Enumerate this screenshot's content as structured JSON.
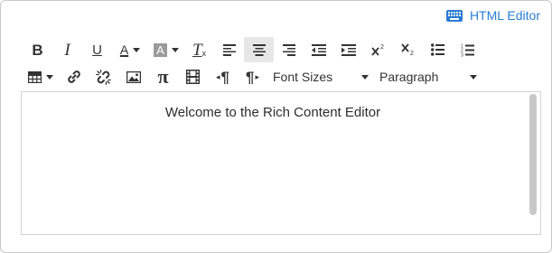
{
  "header": {
    "html_editor_label": "HTML Editor"
  },
  "toolbar": {
    "font_sizes_label": "Font Sizes",
    "paragraph_label": "Paragraph",
    "bold_glyph": "B",
    "italic_glyph": "I",
    "underline_glyph": "U",
    "text_color_glyph": "A",
    "bg_color_glyph": "A",
    "clear_format_glyph": "T",
    "pi_glyph": "π",
    "ltr_glyph": "¶",
    "rtl_glyph": "¶"
  },
  "editor": {
    "content": "Welcome to the Rich Content Editor"
  },
  "colors": {
    "link_blue": "#2a7cd1",
    "icon": "#333333",
    "border": "#c9c9c9"
  }
}
